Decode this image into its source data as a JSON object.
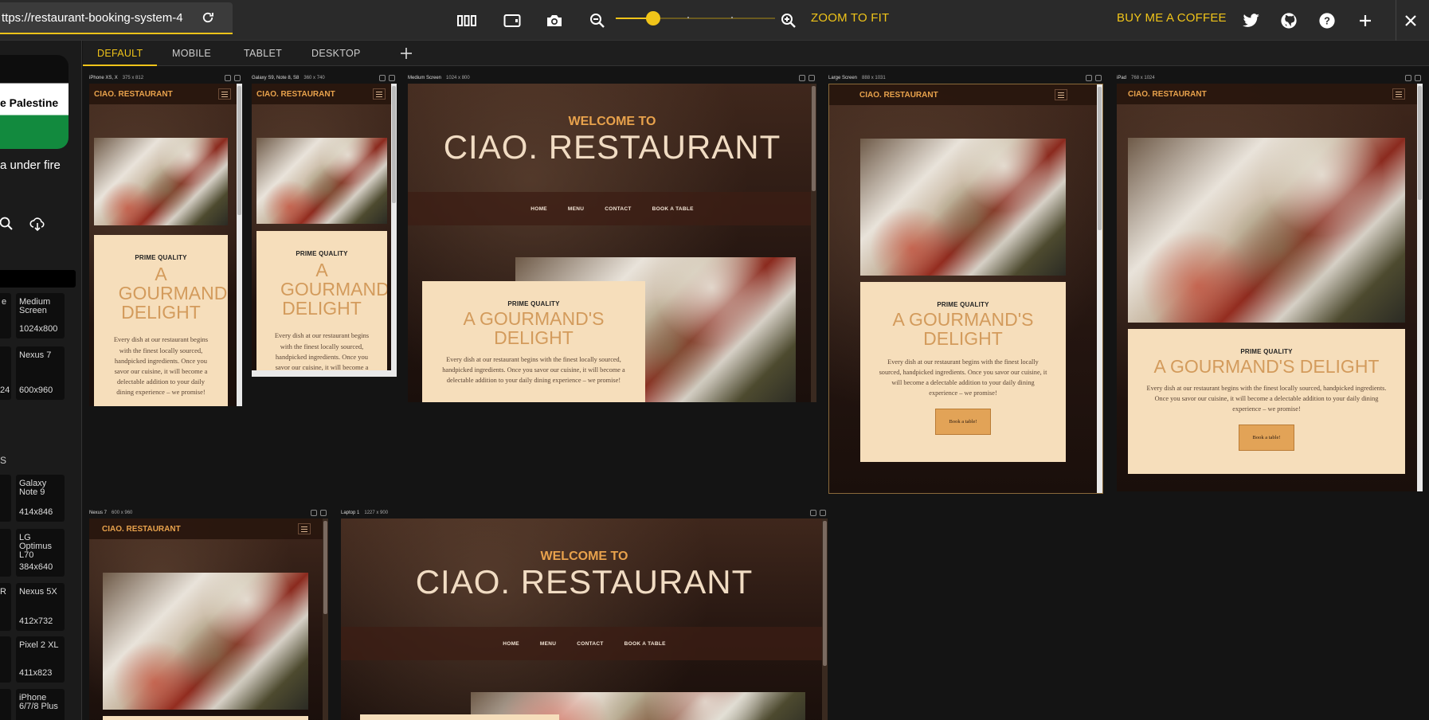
{
  "topbar": {
    "url": "ttps://restaurant-booking-system-4",
    "zoom_fit": "ZOOM TO FIT",
    "coffee": "BUY ME A COFFEE",
    "zoom_level": 0.2,
    "icons": [
      "layout-columns-icon",
      "rotate-device-icon",
      "camera-icon",
      "zoom-out-icon",
      "zoom-in-icon",
      "twitter-icon",
      "github-icon",
      "help-icon",
      "plus-icon",
      "close-icon"
    ],
    "accent": "#f0c419"
  },
  "sidebar": {
    "banner": "e Palestine",
    "gaza_text": "a under fire",
    "section_head": "S",
    "devices": [
      {
        "name": "e",
        "res": ""
      },
      {
        "name": "Medium Screen",
        "res": "1024x800"
      },
      {
        "name": "",
        "res": "24"
      },
      {
        "name": "Nexus 7",
        "res": "600x960"
      },
      {
        "name": "",
        "res": ""
      },
      {
        "name": "Galaxy Note 9",
        "res": "414x846"
      },
      {
        "name": "",
        "res": ""
      },
      {
        "name": "LG Optimus L70",
        "res": "384x640"
      },
      {
        "name": "R",
        "res": ""
      },
      {
        "name": "Nexus 5X",
        "res": "412x732"
      },
      {
        "name": "",
        "res": ""
      },
      {
        "name": "Pixel 2 XL",
        "res": "411x823"
      },
      {
        "name": "",
        "res": ""
      },
      {
        "name": "iPhone 6/7/8 Plus",
        "res": ""
      }
    ]
  },
  "tabs": [
    "DEFAULT",
    "MOBILE",
    "TABLET",
    "DESKTOP"
  ],
  "site": {
    "brand": "CIAO. RESTAURANT",
    "welcome": "WELCOME TO",
    "title": "CIAO. RESTAURANT",
    "menu": [
      "HOME",
      "MENU",
      "CONTACT",
      "BOOK A TABLE"
    ],
    "prime": "PRIME QUALITY",
    "heading": "A GOURMAND'S DELIGHT",
    "heading_narrow_1": "A",
    "heading_narrow_2": "GOURMAND",
    "heading_narrow_3": "DELIGHT",
    "text": "Every dish at our restaurant begins with the finest locally sourced, handpicked ingredients. Once you savor our cuisine, it will become a delectable addition to your daily dining experience – we promise!",
    "button": "Book a table!"
  },
  "devices": [
    {
      "name": "iPhone XS, X",
      "res": "375 x 812"
    },
    {
      "name": "Galaxy S9, Note 8, S8",
      "res": "360 x 740"
    },
    {
      "name": "Medium Screen",
      "res": "1024 x 800"
    },
    {
      "name": "Large Screen",
      "res": "888 x 1031"
    },
    {
      "name": "iPad",
      "res": "768 x 1024"
    },
    {
      "name": "Nexus 7",
      "res": "600 x 960"
    },
    {
      "name": "Laptop 1",
      "res": "1227 x 900"
    }
  ]
}
